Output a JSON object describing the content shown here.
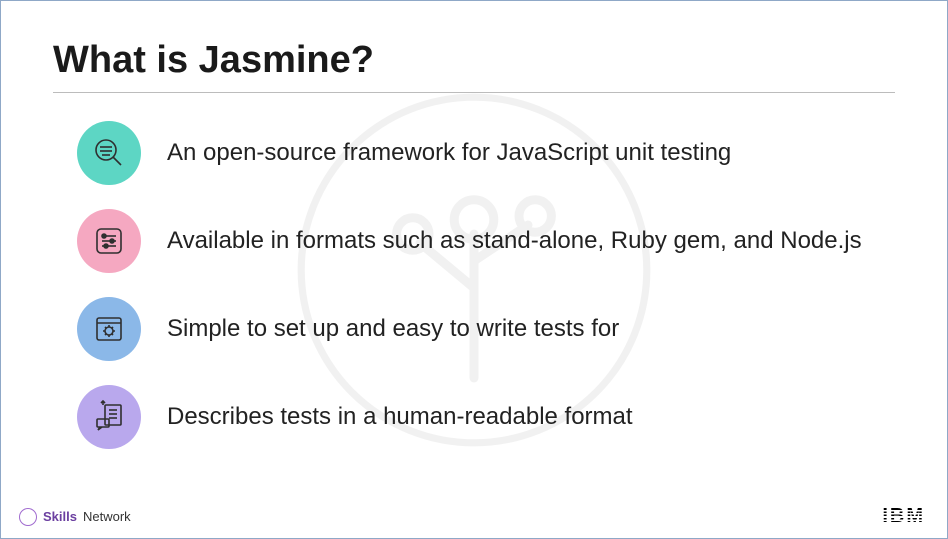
{
  "title": "What is Jasmine?",
  "items": [
    {
      "text": "An open-source framework for JavaScript unit testing",
      "color": "#5dd6c4",
      "icon": "search-analysis-icon"
    },
    {
      "text": "Available in formats such as stand-alone, Ruby gem, and Node.js",
      "color": "#f5a8c1",
      "icon": "sliders-icon"
    },
    {
      "text": "Simple to set up and easy to write tests for",
      "color": "#8bb8e8",
      "icon": "gear-window-icon"
    },
    {
      "text": "Describes tests in a human-readable format",
      "color": "#b9a8ed",
      "icon": "document-chat-icon"
    }
  ],
  "footer": {
    "skills_strong": "Skills",
    "skills_light": "Network",
    "company": "IBM"
  }
}
